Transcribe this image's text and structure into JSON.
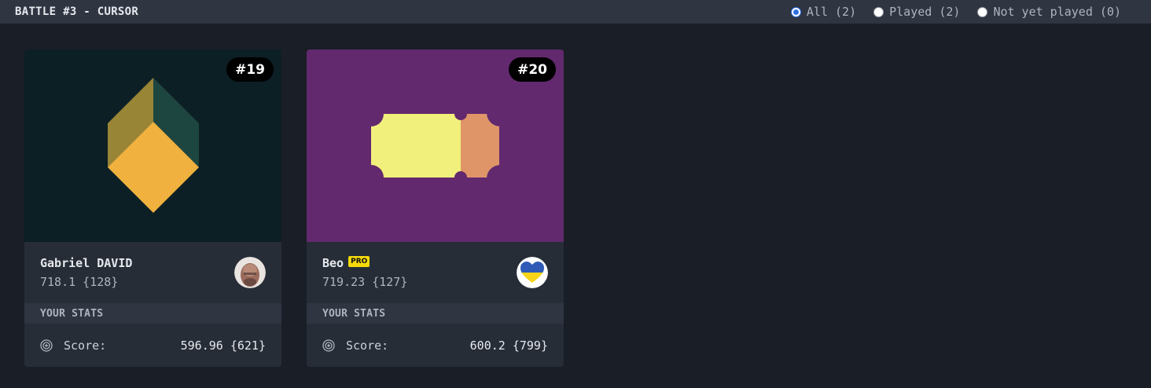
{
  "header": {
    "title": "BATTLE #3 - CURSOR",
    "filters": [
      {
        "label": "All (2)",
        "checked": true
      },
      {
        "label": "Played (2)",
        "checked": false
      },
      {
        "label": "Not yet played (0)",
        "checked": false
      }
    ]
  },
  "cards": [
    {
      "number": "#19",
      "preview_bg": "#0c1f24",
      "player": "Gabriel DAVID",
      "pro": false,
      "score": "718.1 {128}",
      "avatar_icon": "avatar-photo",
      "stats_header": "YOUR STATS",
      "stats_label": "Score:",
      "stats_value": "596.96 {621}"
    },
    {
      "number": "#20",
      "preview_bg": "#62296e",
      "player": "Beo",
      "pro": true,
      "pro_label": "PRO",
      "score": "719.23 {127}",
      "avatar_icon": "ukraine-heart-icon",
      "stats_header": "YOUR STATS",
      "stats_label": "Score:",
      "stats_value": "600.2 {799}"
    }
  ]
}
